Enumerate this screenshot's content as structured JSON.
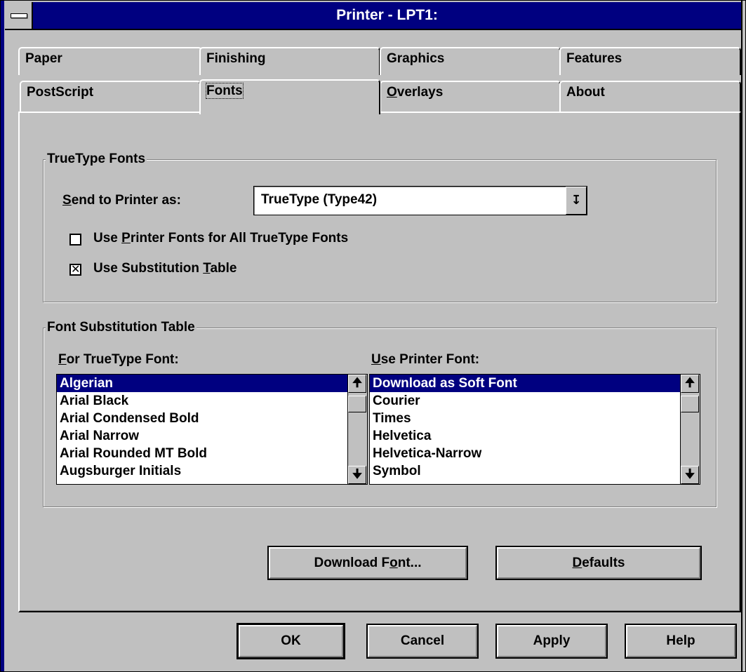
{
  "window": {
    "title": "Printer - LPT1:"
  },
  "tabs": {
    "paper": "Paper",
    "finishing": "Finishing",
    "graphics": "Graphics",
    "features": "Features",
    "postscript": "PostScript",
    "fonts": "Fonts",
    "overlays_prefix": "O",
    "overlays_rest": "verlays",
    "about": "About"
  },
  "truetype_group": {
    "label": "TrueType Fonts",
    "send_label_u": "S",
    "send_label_rest": "end to Printer as:",
    "send_value": "TrueType (Type42)",
    "use_printer_fonts_a": "Use ",
    "use_printer_fonts_u": "P",
    "use_printer_fonts_b": "rinter Fonts for All TrueType Fonts",
    "use_printer_fonts_checked": false,
    "use_sub_a": "Use Substitution ",
    "use_sub_u": "T",
    "use_sub_b": "able",
    "use_sub_checked": true
  },
  "substitution_group": {
    "label": "Font Substitution Table",
    "for_label_u": "F",
    "for_label_rest": "or TrueType Font:",
    "use_label_u": "U",
    "use_label_rest": "se Printer Font:",
    "truetype_fonts": [
      "Algerian",
      "Arial Black",
      "Arial Condensed Bold",
      "Arial Narrow",
      "Arial Rounded MT Bold",
      "Augsburger Initials"
    ],
    "printer_fonts": [
      "Download as Soft Font",
      "Courier",
      "Times",
      "Helvetica",
      "Helvetica-Narrow",
      "Symbol"
    ]
  },
  "buttons": {
    "download_a": "Download F",
    "download_u": "o",
    "download_b": "nt...",
    "defaults_u": "D",
    "defaults_rest": "efaults",
    "ok": "OK",
    "cancel": "Cancel",
    "apply": "Apply",
    "help": "Help"
  },
  "colors": {
    "title_bar": "#000080",
    "face": "#c0c0c0",
    "selection": "#000080"
  }
}
